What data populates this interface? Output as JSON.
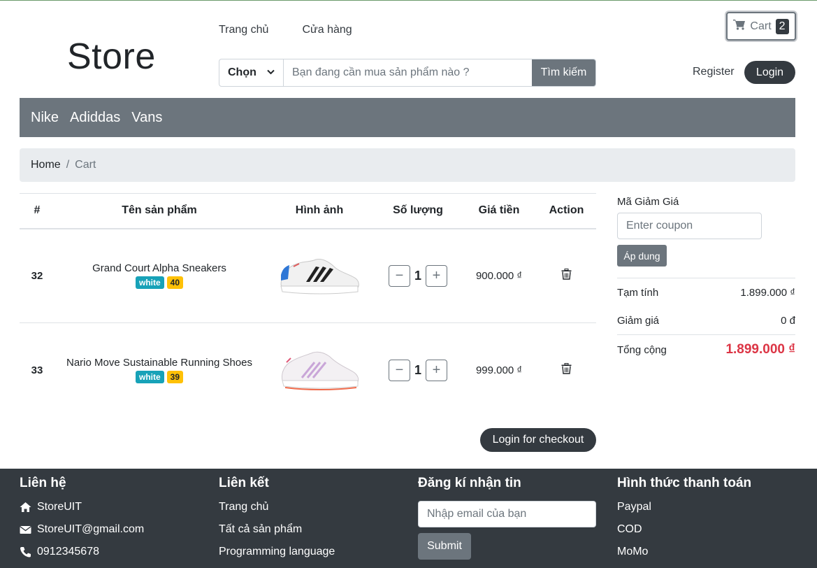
{
  "header": {
    "logo": "Store",
    "nav": [
      "Trang chủ",
      "Cửa hàng"
    ],
    "search": {
      "select_label": "Chọn",
      "placeholder": "Bạn đang cần mua sản phẩm nào ?",
      "button": "Tìm kiếm"
    },
    "cart": {
      "label": "Cart",
      "count": "2"
    },
    "register": "Register",
    "login": "Login"
  },
  "brands": [
    "Nike",
    "Adiddas",
    "Vans"
  ],
  "breadcrumb": {
    "home": "Home",
    "sep": "/",
    "current": "Cart"
  },
  "table": {
    "headers": [
      "#",
      "Tên sản phẩm",
      "Hình ảnh",
      "Số lượng",
      "Giá tiền",
      "Action"
    ],
    "rows": [
      {
        "id": "32",
        "name": "Grand Court Alpha Sneakers",
        "color": "white",
        "size": "40",
        "qty": "1",
        "price": "900.000 ₫",
        "qty_minus": "−",
        "qty_plus": "+"
      },
      {
        "id": "33",
        "name": "Nario Move Sustainable Running Shoes",
        "color": "white",
        "size": "39",
        "qty": "1",
        "price": "999.000 ₫",
        "qty_minus": "−",
        "qty_plus": "+"
      }
    ],
    "checkout_button": "Login for checkout"
  },
  "summary": {
    "coupon_label": "Mã Giảm Giá",
    "coupon_placeholder": "Enter coupon",
    "apply_button": "Áp dung",
    "subtotal_label": "Tạm tính",
    "subtotal_value": "1.899.000 ₫",
    "discount_label": "Giảm giá",
    "discount_value": "0 đ",
    "total_label": "Tổng cộng",
    "total_value": "1.899.000 ₫"
  },
  "footer": {
    "contact": {
      "title": "Liên hệ",
      "items": [
        "StoreUIT",
        "StoreUIT@gmail.com",
        "0912345678"
      ]
    },
    "links": {
      "title": "Liên kết",
      "items": [
        "Trang chủ",
        "Tất cả sản phẩm",
        "Programming language"
      ]
    },
    "newsletter": {
      "title": "Đăng kí nhận tin",
      "placeholder": "Nhập email của bạn",
      "button": "Submit"
    },
    "payment": {
      "title": "Hình thức thanh toán",
      "items": [
        "Paypal",
        "COD",
        "MoMo"
      ]
    }
  },
  "colors": {
    "dark": "#343a40",
    "secondary": "#6c757d",
    "info_badge": "#17a2b8",
    "warning_badge": "#ffc107",
    "total_red": "#dc3545"
  }
}
